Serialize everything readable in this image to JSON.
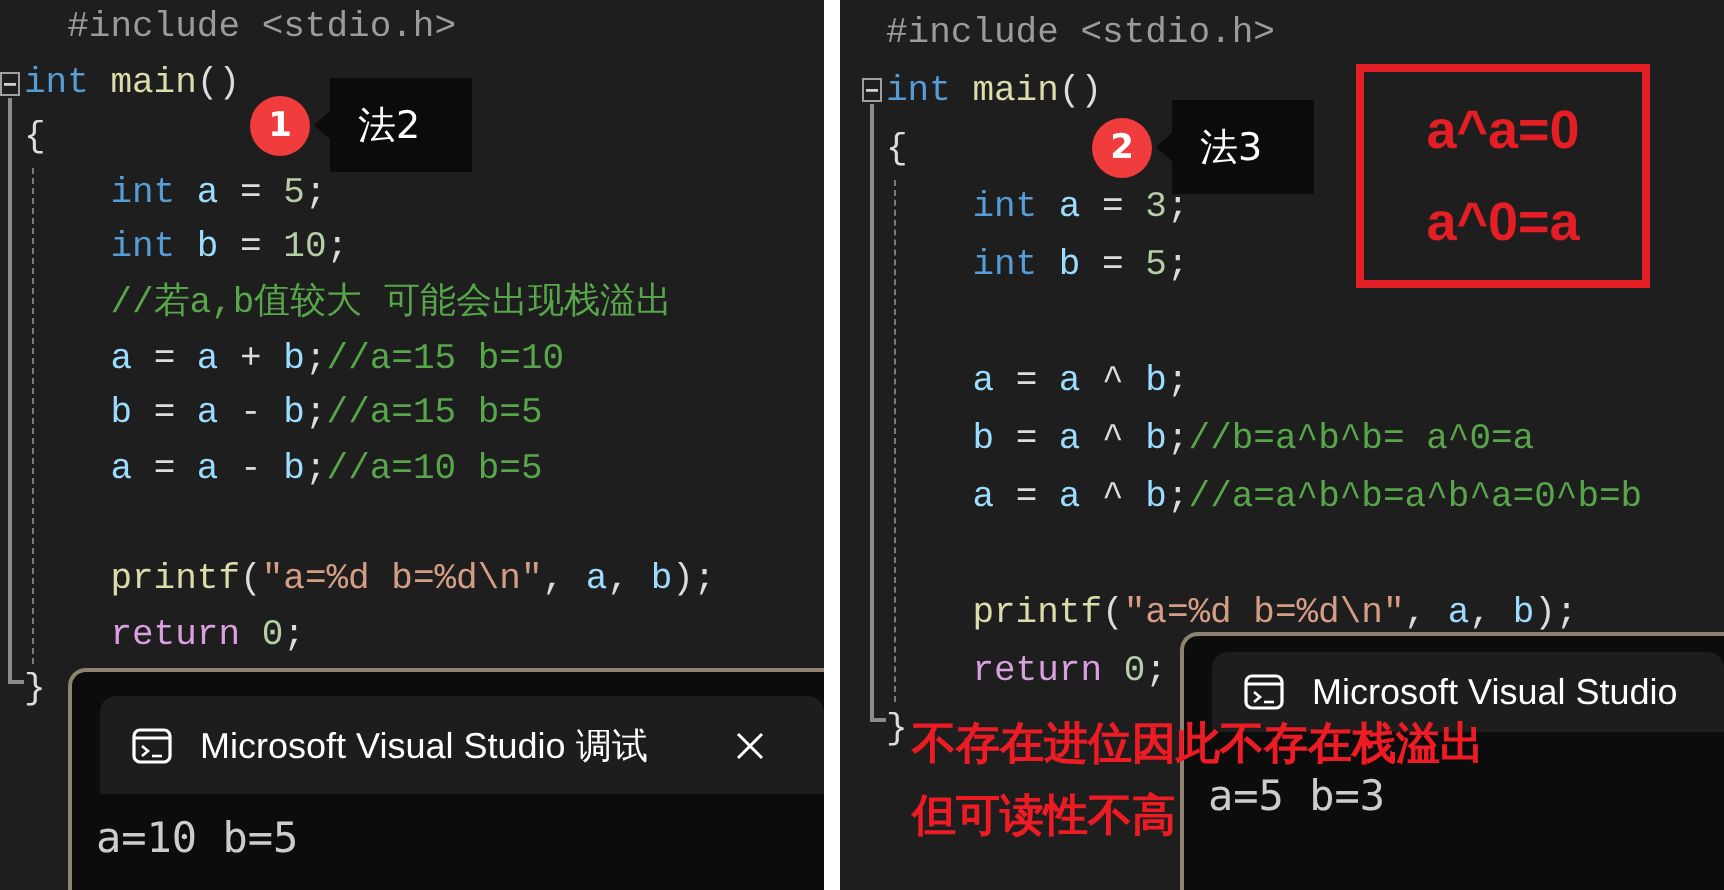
{
  "panels": [
    {
      "lines": [
        {
          "kind": "code",
          "tokens": [
            {
              "kind": "preproc",
              "text": "  #include <stdio.h>"
            }
          ]
        },
        {
          "kind": "code",
          "tokens": [
            {
              "kind": "keyword",
              "text": "int"
            },
            {
              "kind": "func",
              "text": " main"
            },
            {
              "kind": "plain",
              "text": "()"
            }
          ]
        },
        {
          "kind": "code",
          "tokens": [
            {
              "kind": "plain",
              "text": "{"
            }
          ]
        },
        {
          "kind": "code",
          "tokens": [
            {
              "kind": "keyword",
              "text": "    int"
            },
            {
              "kind": "var",
              "text": " a"
            },
            {
              "kind": "plain",
              "text": " = "
            },
            {
              "kind": "number",
              "text": "5"
            },
            {
              "kind": "plain",
              "text": ";"
            }
          ]
        },
        {
          "kind": "code",
          "tokens": [
            {
              "kind": "keyword",
              "text": "    int"
            },
            {
              "kind": "var",
              "text": " b"
            },
            {
              "kind": "plain",
              "text": " = "
            },
            {
              "kind": "number",
              "text": "10"
            },
            {
              "kind": "plain",
              "text": ";"
            }
          ]
        },
        {
          "kind": "code",
          "tokens": [
            {
              "kind": "comment",
              "text": "    //若a,b值较大 可能会出现栈溢出"
            }
          ]
        },
        {
          "kind": "code",
          "tokens": [
            {
              "kind": "var",
              "text": "    a"
            },
            {
              "kind": "plain",
              "text": " = "
            },
            {
              "kind": "var",
              "text": "a"
            },
            {
              "kind": "plain",
              "text": " + "
            },
            {
              "kind": "var",
              "text": "b"
            },
            {
              "kind": "plain",
              "text": ";"
            },
            {
              "kind": "comment",
              "text": "//a=15 b=10"
            }
          ]
        },
        {
          "kind": "code",
          "tokens": [
            {
              "kind": "var",
              "text": "    b"
            },
            {
              "kind": "plain",
              "text": " = "
            },
            {
              "kind": "var",
              "text": "a"
            },
            {
              "kind": "plain",
              "text": " - "
            },
            {
              "kind": "var",
              "text": "b"
            },
            {
              "kind": "plain",
              "text": ";"
            },
            {
              "kind": "comment",
              "text": "//a=15 b=5"
            }
          ]
        },
        {
          "kind": "code",
          "tokens": [
            {
              "kind": "var",
              "text": "    a"
            },
            {
              "kind": "plain",
              "text": " = "
            },
            {
              "kind": "var",
              "text": "a"
            },
            {
              "kind": "plain",
              "text": " - "
            },
            {
              "kind": "var",
              "text": "b"
            },
            {
              "kind": "plain",
              "text": ";"
            },
            {
              "kind": "comment",
              "text": "//a=10 b=5"
            }
          ]
        },
        {
          "kind": "blank"
        },
        {
          "kind": "code",
          "tokens": [
            {
              "kind": "func",
              "text": "    printf"
            },
            {
              "kind": "plain",
              "text": "("
            },
            {
              "kind": "string",
              "text": "\"a=%d b=%d\\n\""
            },
            {
              "kind": "plain",
              "text": ", "
            },
            {
              "kind": "var",
              "text": "a"
            },
            {
              "kind": "plain",
              "text": ", "
            },
            {
              "kind": "var",
              "text": "b"
            },
            {
              "kind": "plain",
              "text": ");"
            }
          ]
        },
        {
          "kind": "code",
          "tokens": [
            {
              "kind": "control",
              "text": "    return"
            },
            {
              "kind": "number",
              "text": " 0"
            },
            {
              "kind": "plain",
              "text": ";"
            }
          ]
        },
        {
          "kind": "code",
          "tokens": [
            {
              "kind": "plain",
              "text": "}"
            }
          ]
        }
      ],
      "callout": {
        "badge": "1",
        "label": "法2"
      },
      "console": {
        "title": "Microsoft Visual Studio 调试",
        "output": "a=10 b=5"
      }
    },
    {
      "lines": [
        {
          "kind": "code",
          "tokens": [
            {
              "kind": "preproc",
              "text": "#include <stdio.h>"
            }
          ]
        },
        {
          "kind": "code",
          "tokens": [
            {
              "kind": "keyword",
              "text": "int"
            },
            {
              "kind": "func",
              "text": " main"
            },
            {
              "kind": "plain",
              "text": "()"
            }
          ]
        },
        {
          "kind": "code",
          "tokens": [
            {
              "kind": "plain",
              "text": "{"
            }
          ]
        },
        {
          "kind": "code",
          "tokens": [
            {
              "kind": "keyword",
              "text": "    int"
            },
            {
              "kind": "var",
              "text": " a"
            },
            {
              "kind": "plain",
              "text": " = "
            },
            {
              "kind": "number",
              "text": "3"
            },
            {
              "kind": "plain",
              "text": ";"
            }
          ]
        },
        {
          "kind": "code",
          "tokens": [
            {
              "kind": "keyword",
              "text": "    int"
            },
            {
              "kind": "var",
              "text": " b"
            },
            {
              "kind": "plain",
              "text": " = "
            },
            {
              "kind": "number",
              "text": "5"
            },
            {
              "kind": "plain",
              "text": ";"
            }
          ]
        },
        {
          "kind": "blank"
        },
        {
          "kind": "code",
          "tokens": [
            {
              "kind": "var",
              "text": "    a"
            },
            {
              "kind": "plain",
              "text": " = "
            },
            {
              "kind": "var",
              "text": "a"
            },
            {
              "kind": "plain",
              "text": " ^ "
            },
            {
              "kind": "var",
              "text": "b"
            },
            {
              "kind": "plain",
              "text": ";"
            }
          ]
        },
        {
          "kind": "code",
          "tokens": [
            {
              "kind": "var",
              "text": "    b"
            },
            {
              "kind": "plain",
              "text": " = "
            },
            {
              "kind": "var",
              "text": "a"
            },
            {
              "kind": "plain",
              "text": " ^ "
            },
            {
              "kind": "var",
              "text": "b"
            },
            {
              "kind": "plain",
              "text": ";"
            },
            {
              "kind": "comment",
              "text": "//b=a^b^b= a^0=a"
            }
          ]
        },
        {
          "kind": "code",
          "tokens": [
            {
              "kind": "var",
              "text": "    a"
            },
            {
              "kind": "plain",
              "text": " = "
            },
            {
              "kind": "var",
              "text": "a"
            },
            {
              "kind": "plain",
              "text": " ^ "
            },
            {
              "kind": "var",
              "text": "b"
            },
            {
              "kind": "plain",
              "text": ";"
            },
            {
              "kind": "comment",
              "text": "//a=a^b^b=a^b^a=0^b=b"
            }
          ]
        },
        {
          "kind": "blank"
        },
        {
          "kind": "code",
          "tokens": [
            {
              "kind": "func",
              "text": "    printf"
            },
            {
              "kind": "plain",
              "text": "("
            },
            {
              "kind": "string",
              "text": "\"a=%d b=%d\\n\""
            },
            {
              "kind": "plain",
              "text": ", "
            },
            {
              "kind": "var",
              "text": "a"
            },
            {
              "kind": "plain",
              "text": ", "
            },
            {
              "kind": "var",
              "text": "b"
            },
            {
              "kind": "plain",
              "text": ");"
            }
          ]
        },
        {
          "kind": "code",
          "tokens": [
            {
              "kind": "control",
              "text": "    return"
            },
            {
              "kind": "number",
              "text": " 0"
            },
            {
              "kind": "plain",
              "text": ";"
            }
          ]
        },
        {
          "kind": "code",
          "tokens": [
            {
              "kind": "plain",
              "text": "}"
            }
          ]
        }
      ],
      "callout": {
        "badge": "2",
        "label": "法3"
      },
      "note_box": {
        "lines": [
          "a^a=0",
          "a^0=a"
        ]
      },
      "console": {
        "title": "Microsoft Visual Studio",
        "output": "a=5 b=3"
      },
      "overlay_text": [
        "不存在进位因此不存在栈溢出",
        "但可读性不高"
      ]
    }
  ]
}
